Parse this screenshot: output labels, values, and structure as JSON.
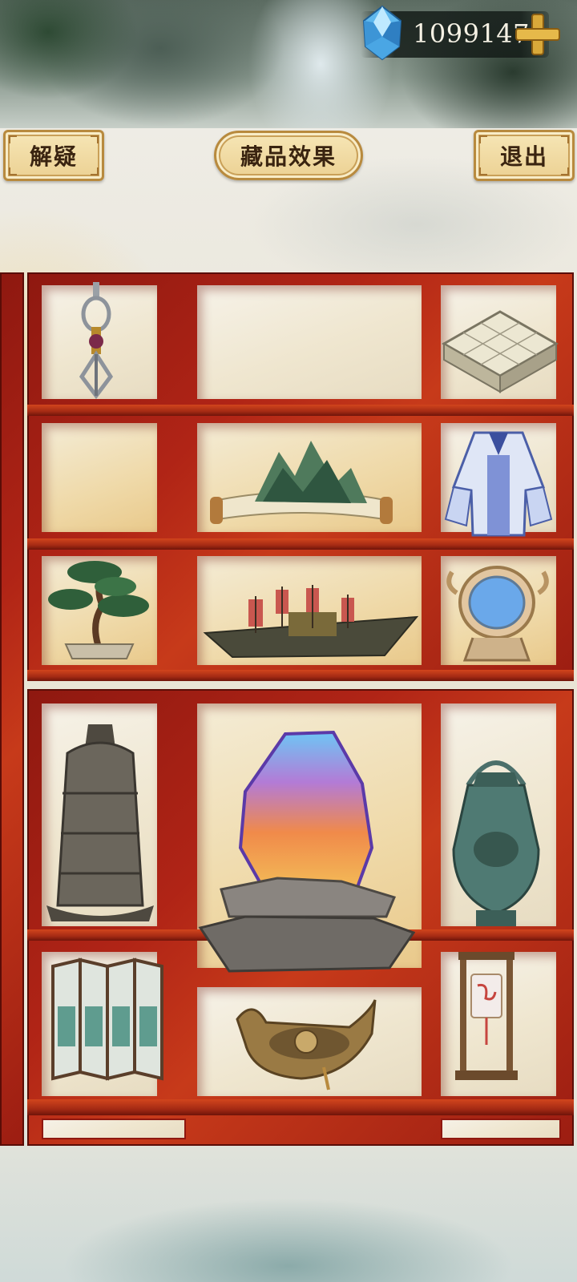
{
  "header": {
    "gem_count": "1099147",
    "gem_icon": "blue-crystal-icon",
    "add_icon": "gold-plus-icon"
  },
  "toolbar": {
    "help_label": "解疑",
    "title_label": "藏品效果",
    "exit_label": "退出"
  },
  "colors": {
    "shelf_red": "#b02416",
    "button_gold": "#ecd193",
    "button_border": "#b88a3e"
  },
  "shelf": {
    "items": [
      {
        "icon": "vajra-icon"
      },
      {
        "icon": "go-board-icon"
      },
      {
        "icon": "landscape-scroll-icon"
      },
      {
        "icon": "blue-robe-icon"
      },
      {
        "icon": "bonsai-pine-icon"
      },
      {
        "icon": "war-junk-ship-icon"
      },
      {
        "icon": "bronze-mirror-icon"
      },
      {
        "icon": "bronze-bell-icon"
      },
      {
        "icon": "rainbow-stone-icon"
      },
      {
        "icon": "bronze-ewer-icon"
      },
      {
        "icon": "folding-screen-icon"
      },
      {
        "icon": "dragon-boat-icon"
      },
      {
        "icon": "hanging-lantern-icon"
      }
    ]
  }
}
